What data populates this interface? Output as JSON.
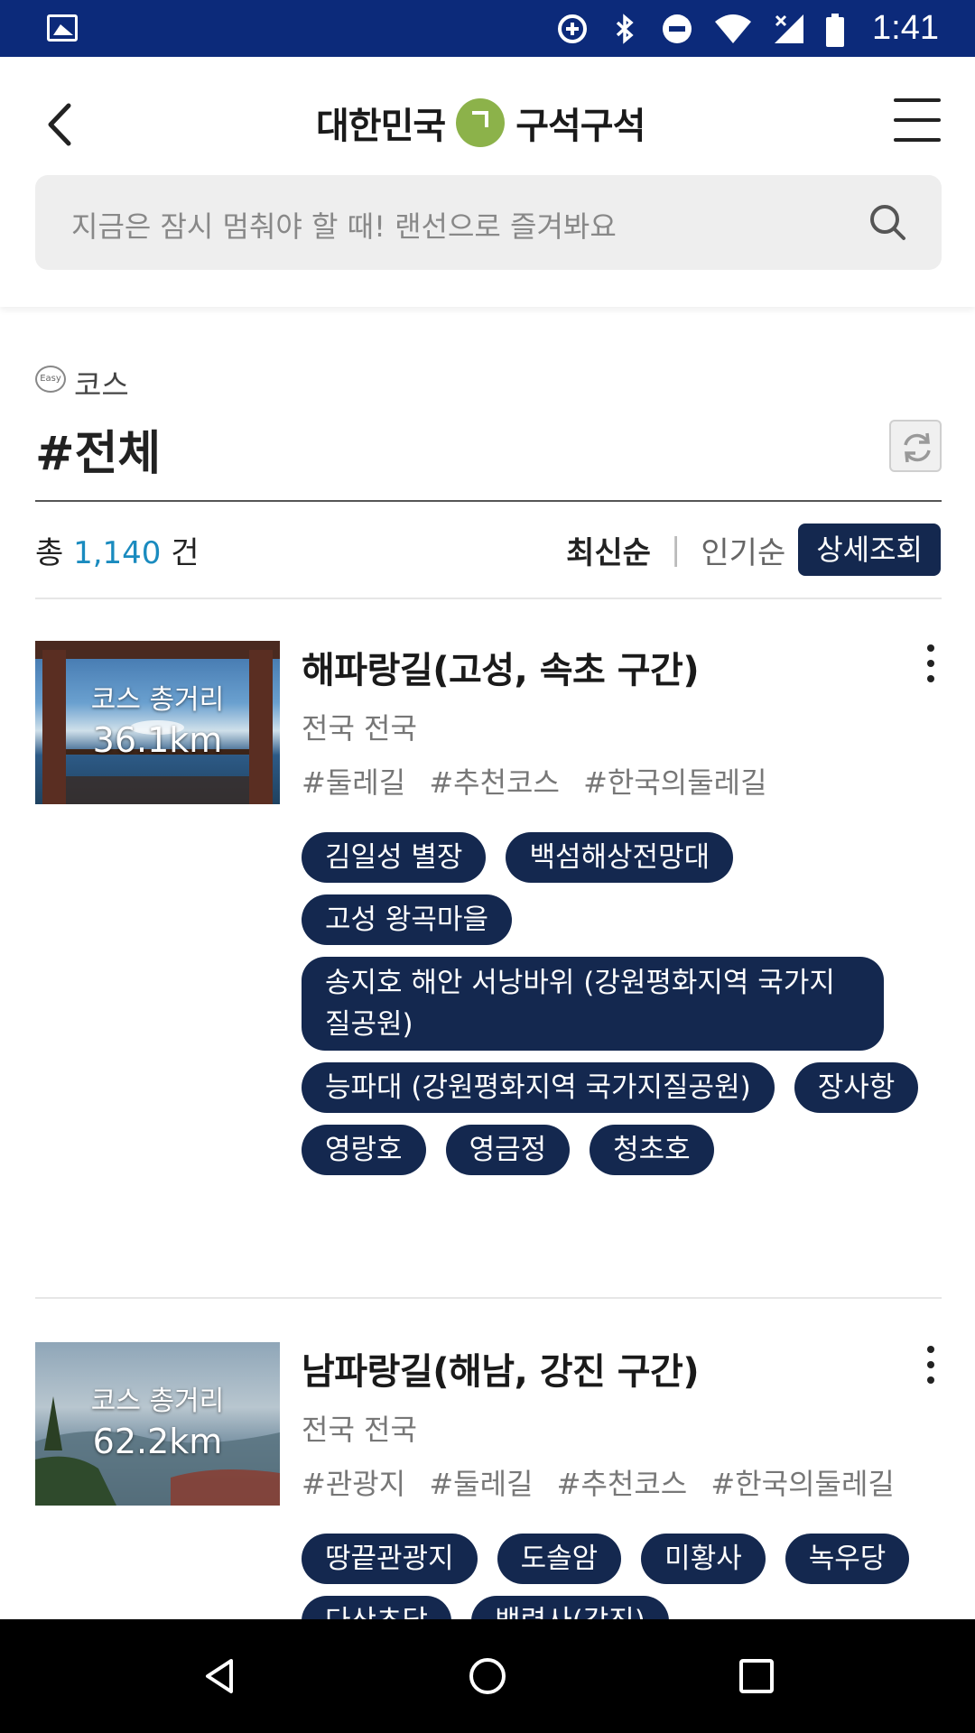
{
  "status_bar": {
    "time": "1:41",
    "icons": [
      "gallery-icon",
      "data-saver-icon",
      "bluetooth-icon",
      "do-not-disturb-icon",
      "wifi-icon",
      "signal-icon",
      "battery-icon"
    ],
    "background": "#0c2a7a"
  },
  "header": {
    "logo_left": "대한민국",
    "logo_right": "구석구석",
    "logo_color": "#8cb24a"
  },
  "search": {
    "placeholder": "지금은 잠시 멈춰야 할 때! 랜선으로 즐겨봐요"
  },
  "section": {
    "easy_label": "Easy",
    "category": "코스",
    "title": "#전체"
  },
  "results": {
    "prefix": "총",
    "count": "1,140",
    "suffix": "건"
  },
  "sort": {
    "latest": "최신순",
    "separator": "|",
    "popular": "인기순",
    "detail": "상세조회"
  },
  "items": [
    {
      "thumb_label": "코스 총거리",
      "distance": "36.1km",
      "title": "해파랑길(고성, 속초 구간)",
      "region": "전국 전국",
      "tags": [
        "#둘레길",
        "#추천코스",
        "#한국의둘레길"
      ],
      "chips": [
        "김일성 별장",
        "백섬해상전망대",
        "고성 왕곡마을",
        "송지호 해안 서낭바위 (강원평화지역 국가지질공원)",
        "능파대 (강원평화지역 국가지질공원)",
        "장사항",
        "영랑호",
        "영금정",
        "청초호"
      ]
    },
    {
      "thumb_label": "코스 총거리",
      "distance": "62.2km",
      "title": "남파랑길(해남, 강진 구간)",
      "region": "전국 전국",
      "tags": [
        "#관광지",
        "#둘레길",
        "#추천코스",
        "#한국의둘레길"
      ],
      "chips": [
        "땅끝관광지",
        "도솔암",
        "미황사",
        "녹우당",
        "다산초당",
        "백련사(강진)"
      ]
    }
  ],
  "colors": {
    "accent_navy": "#14284f",
    "count_blue": "#1a8bbf"
  }
}
